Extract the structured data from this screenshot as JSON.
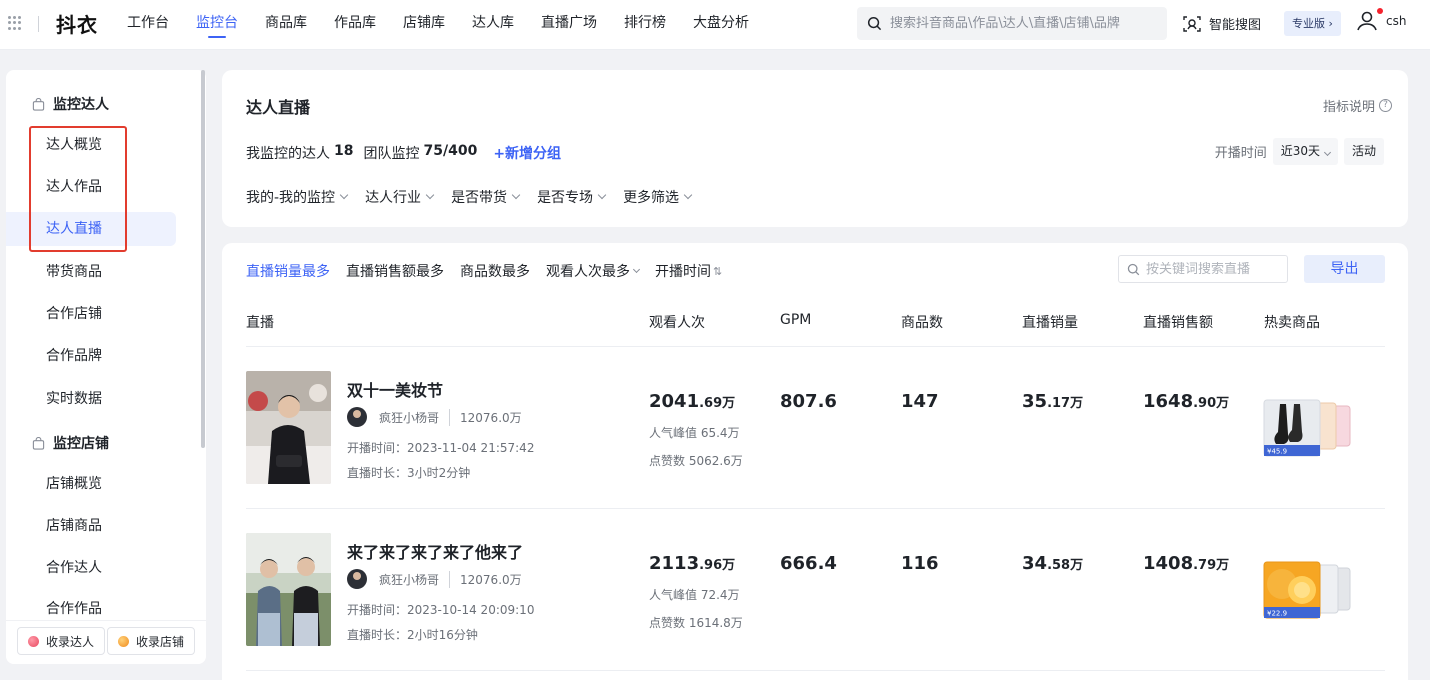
{
  "topbar": {
    "logo": "抖衣",
    "nav": [
      "工作台",
      "监控台",
      "商品库",
      "作品库",
      "店铺库",
      "达人库",
      "直播广场",
      "排行榜",
      "大盘分析"
    ],
    "active_nav": "监控台",
    "search_placeholder": "搜索抖音商品\\作品\\达人\\直播\\店铺\\品牌",
    "smart_search": "智能搜图",
    "pro_badge": "专业版 ›",
    "username": "csh"
  },
  "sidebar": {
    "sections": [
      {
        "title": "监控达人",
        "items": [
          "达人概览",
          "达人作品",
          "达人直播",
          "带货商品",
          "合作店铺",
          "合作品牌",
          "实时数据"
        ]
      },
      {
        "title": "监控店铺",
        "items": [
          "店铺概览",
          "店铺商品",
          "合作达人",
          "合作作品"
        ]
      }
    ],
    "active_item": "达人直播",
    "fav_influencer": "收录达人",
    "fav_shop": "收录店铺"
  },
  "filter_card": {
    "title": "达人直播",
    "metric_help": "指标说明",
    "monitored_label": "我监控的达人",
    "monitored_count": "18",
    "team_label": "团队监控",
    "team_count": "75/400",
    "add_group": "+新增分组",
    "time_label": "开播时间",
    "time_value": "近30天",
    "activity": "活动",
    "filters": [
      "我的-我的监控",
      "达人行业",
      "是否带货",
      "是否专场",
      "更多筛选"
    ]
  },
  "table": {
    "sort_tabs": [
      "直播销量最多",
      "直播销售额最多",
      "商品数最多",
      "观看人次最多",
      "开播时间"
    ],
    "active_sort": "直播销量最多",
    "search_placeholder": "按关键词搜索直播",
    "export": "导出",
    "columns": [
      "直播",
      "观看人次",
      "GPM",
      "商品数",
      "直播销量",
      "直播销售额",
      "热卖商品"
    ],
    "rows": [
      {
        "title": "双十一美妆节",
        "anchor": "疯狂小杨哥",
        "fans": "12076.0万",
        "start_time": "开播时间：2023-11-04 21:57:42",
        "duration": "直播时长：3小时2分钟",
        "views_int": "2041",
        "views_dec": ".69万",
        "peak": "人气峰值 65.4万",
        "likes": "点赞数 5062.6万",
        "gpm": "807.6",
        "products": "147",
        "sales_int": "35",
        "sales_dec": ".17万",
        "revenue_int": "1648",
        "revenue_dec": ".90万",
        "hot_tag": "¥45.9"
      },
      {
        "title": "来了来了来了来了他来了",
        "anchor": "疯狂小杨哥",
        "fans": "12076.0万",
        "start_time": "开播时间：2023-10-14 20:09:10",
        "duration": "直播时长：2小时16分钟",
        "views_int": "2113",
        "views_dec": ".96万",
        "peak": "人气峰值 72.4万",
        "likes": "点赞数 1614.8万",
        "gpm": "666.4",
        "products": "116",
        "sales_int": "34",
        "sales_dec": ".58万",
        "revenue_int": "1408",
        "revenue_dec": ".79万",
        "hot_tag": "¥22.9"
      }
    ]
  },
  "colors": {
    "accent": "#3d63f5",
    "highlight_box": "#e23c2e"
  }
}
